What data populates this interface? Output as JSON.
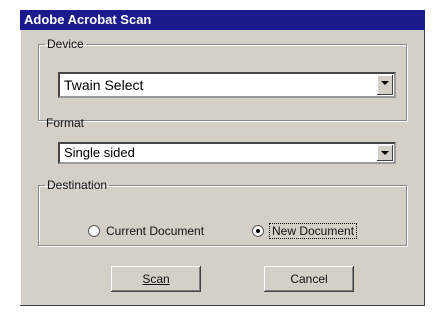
{
  "window": {
    "title": "Adobe Acrobat Scan"
  },
  "device": {
    "label": "Device",
    "selected": "Twain Select"
  },
  "format": {
    "label": "Format",
    "selected": "Single sided"
  },
  "destination": {
    "label": "Destination",
    "options": [
      {
        "label": "Current Document",
        "selected": false
      },
      {
        "label": "New Document",
        "selected": true
      }
    ]
  },
  "buttons": {
    "scan": "Scan",
    "cancel": "Cancel"
  }
}
